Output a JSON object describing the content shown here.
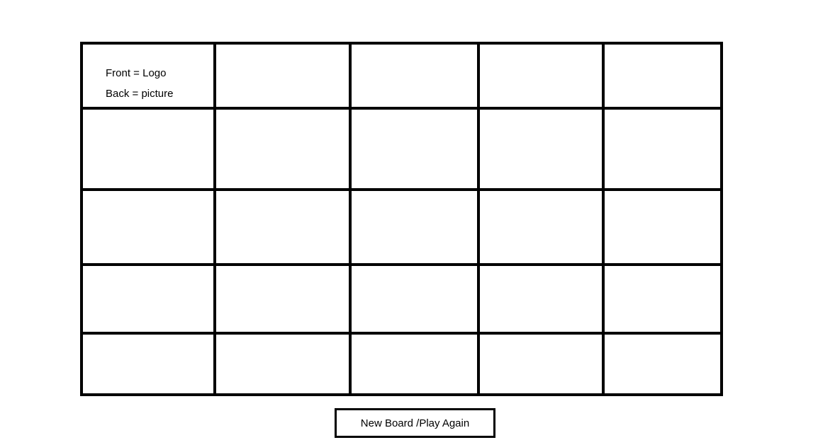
{
  "board": {
    "rows": 5,
    "columns": 5,
    "note": {
      "front": "Front = Logo",
      "back": "Back = picture"
    }
  },
  "controls": {
    "new_board_label": "New Board /Play Again"
  },
  "colors": {
    "line": "#000000",
    "background": "#ffffff"
  }
}
